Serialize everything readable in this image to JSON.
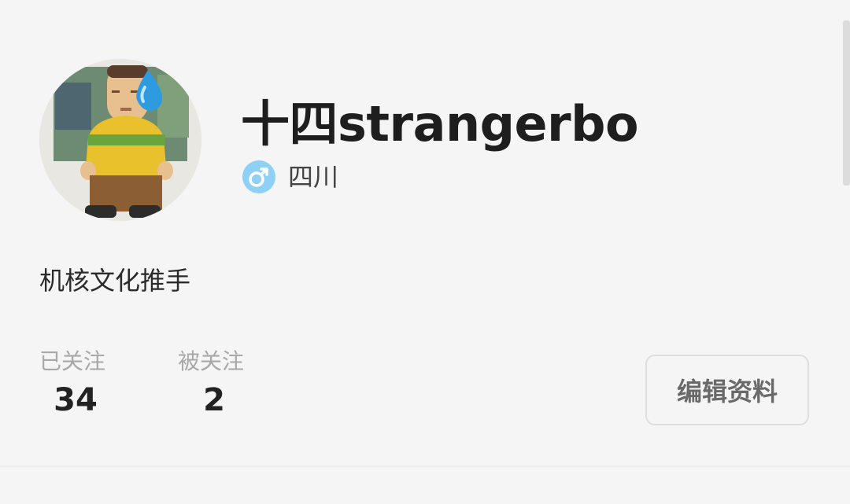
{
  "profile": {
    "username": "十四strangerbo",
    "location": "四川",
    "bio": "机核文化推手",
    "avatar_icon": "avatar-image",
    "gender_icon": "male-icon",
    "gender_color": "#8fd0f5"
  },
  "stats": {
    "following_label": "已关注",
    "following_count": "34",
    "followers_label": "被关注",
    "followers_count": "2"
  },
  "actions": {
    "edit_profile_label": "编辑资料"
  }
}
